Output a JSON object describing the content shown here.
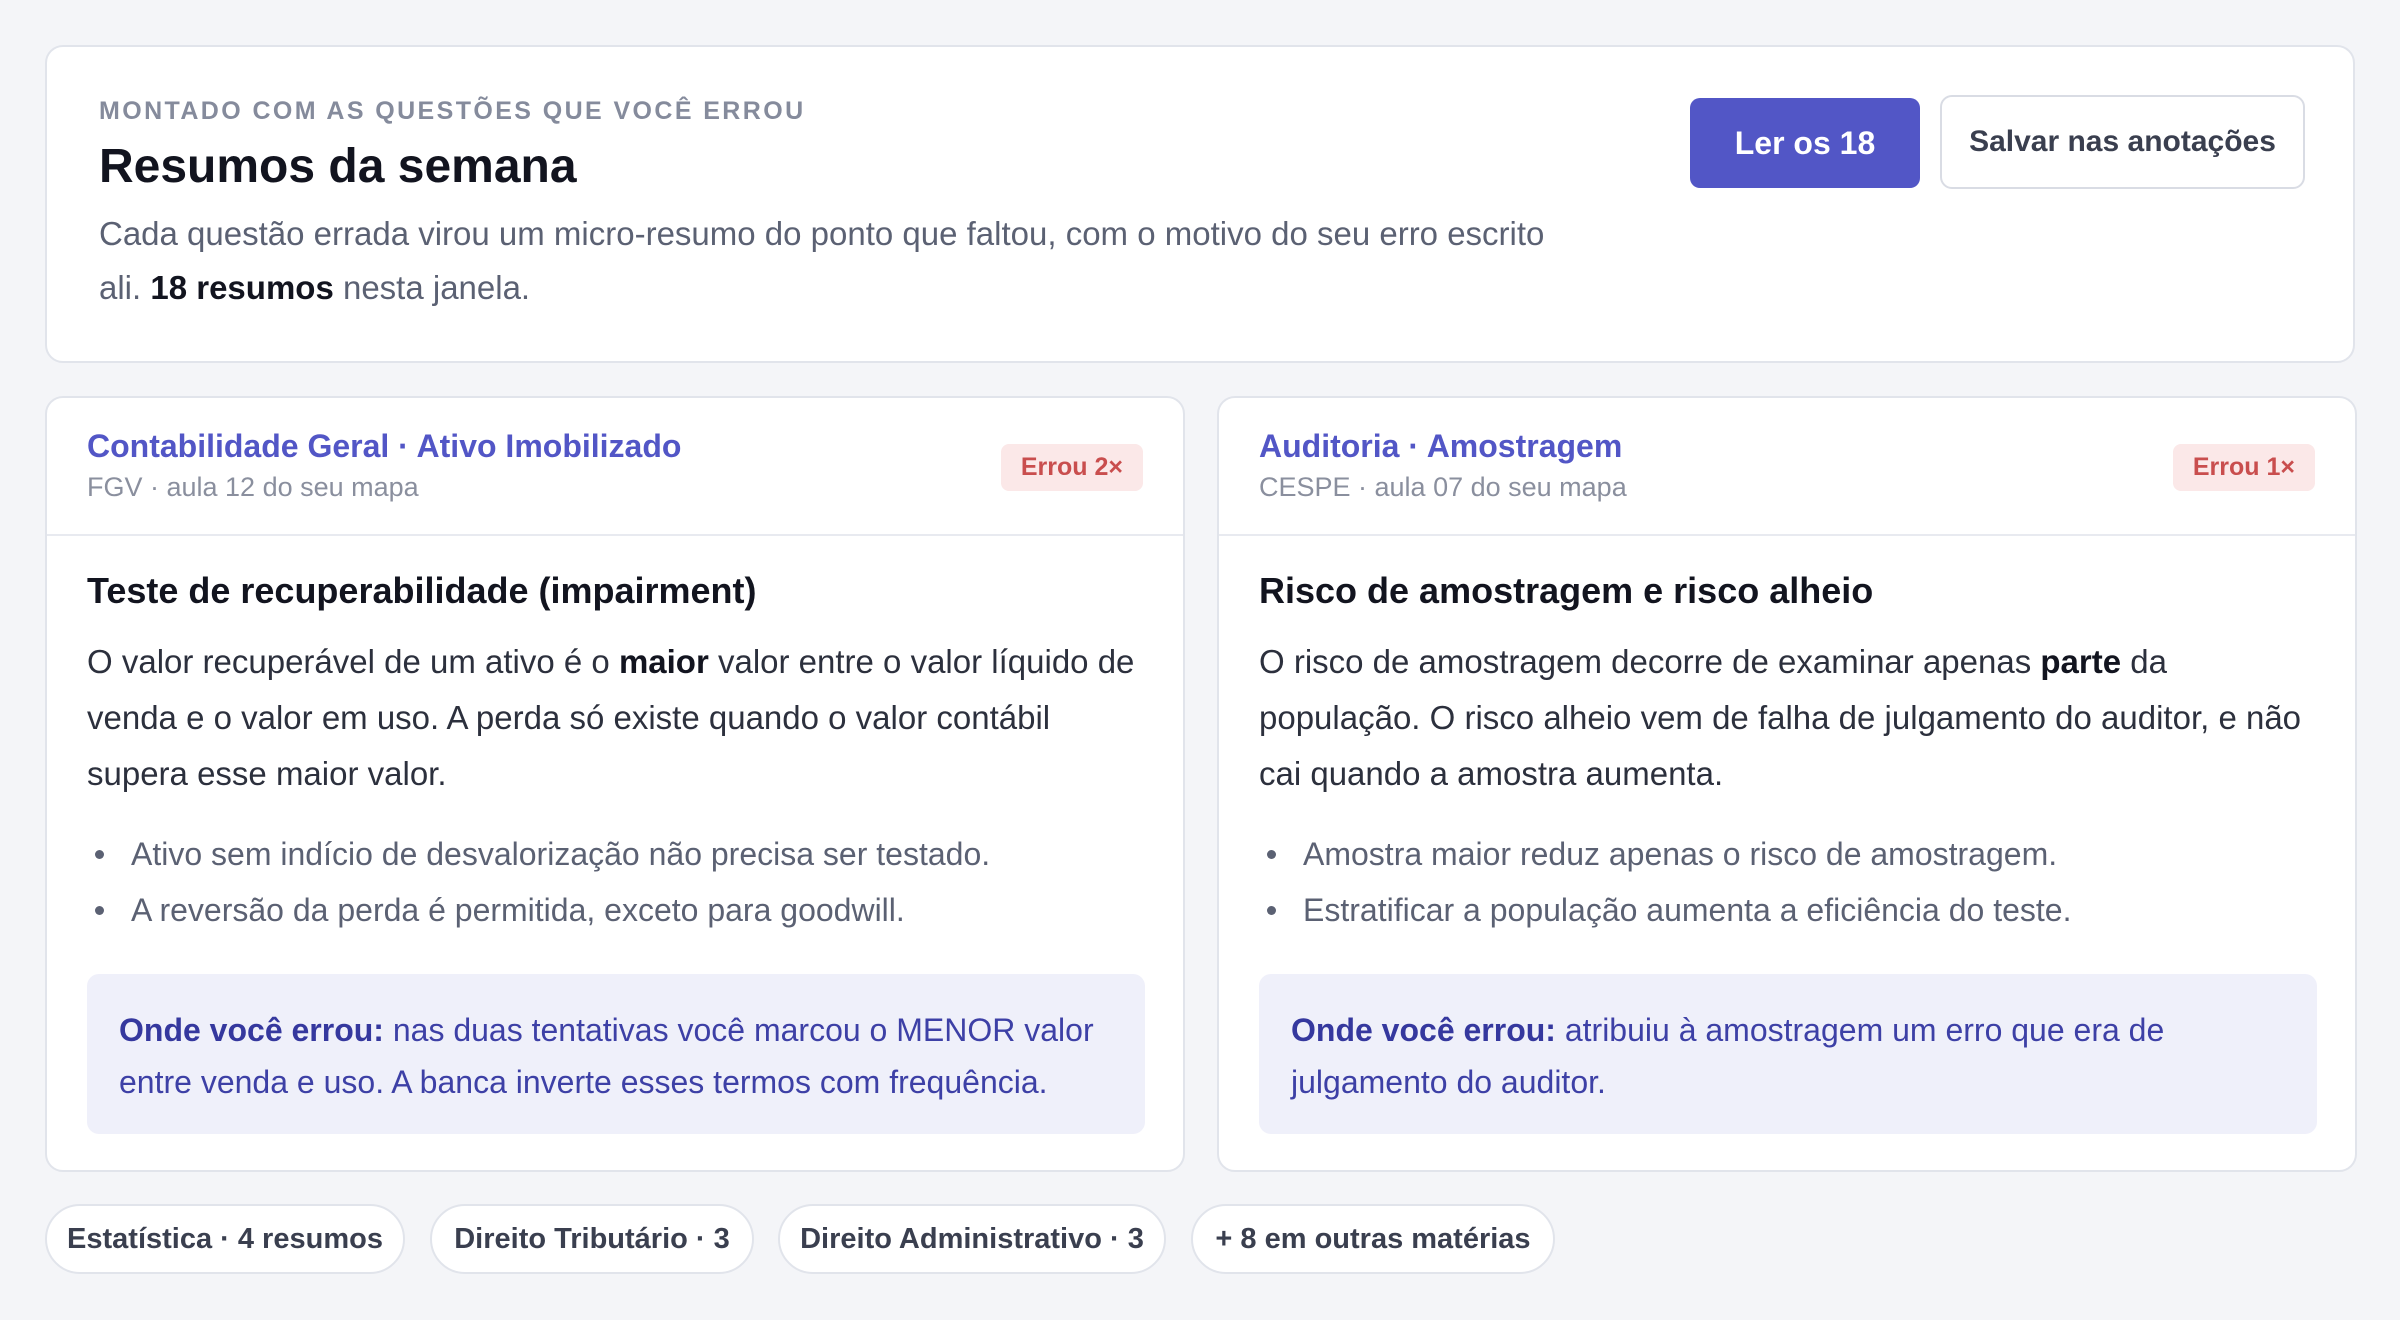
{
  "header": {
    "eyebrow": "MONTADO COM AS QUESTÕES QUE VOCÊ ERROU",
    "title": "Resumos da semana",
    "description_before": "Cada questão errada virou um micro-resumo do ponto que faltou, com o motivo do seu erro escrito ali. ",
    "description_bold": "18 resumos",
    "description_after": " nesta janela.",
    "primary_button": "Ler os 18",
    "secondary_button": "Salvar nas anotações"
  },
  "cards": [
    {
      "subject": "Contabilidade Geral · Ativo Imobilizado",
      "meta": "FGV · aula 12 do seu mapa",
      "badge": "Errou 2×",
      "title": "Teste de recuperabilidade (impairment)",
      "body_before": "O valor recuperável de um ativo é o ",
      "body_bold": "maior",
      "body_after": " valor entre o valor líquido de venda e o valor em uso. A perda só existe quando o valor contábil supera esse maior valor.",
      "bullets": [
        "Ativo sem indício de desvalorização não precisa ser testado.",
        "A reversão da perda é permitida, exceto para goodwill."
      ],
      "note_label": "Onde você errou:",
      "note_text": " nas duas tentativas você marcou o MENOR valor entre venda e uso. A banca inverte esses termos com frequência."
    },
    {
      "subject": "Auditoria · Amostragem",
      "meta": "CESPE · aula 07 do seu mapa",
      "badge": "Errou 1×",
      "title": "Risco de amostragem e risco alheio",
      "body_before": "O risco de amostragem decorre de examinar apenas ",
      "body_bold": "parte",
      "body_after": " da população. O risco alheio vem de falha de julgamento do auditor, e não cai quando a amostra aumenta.",
      "bullets": [
        "Amostra maior reduz apenas o risco de amostragem.",
        "Estratificar a população aumenta a eficiência do teste."
      ],
      "note_label": "Onde você errou:",
      "note_text": " atribuiu à amostragem um erro que era de julgamento do auditor."
    }
  ],
  "chips": [
    "Estatística · 4 resumos",
    "Direito Tributário · 3",
    "Direito Administrativo · 3",
    "+ 8 em outras matérias"
  ]
}
